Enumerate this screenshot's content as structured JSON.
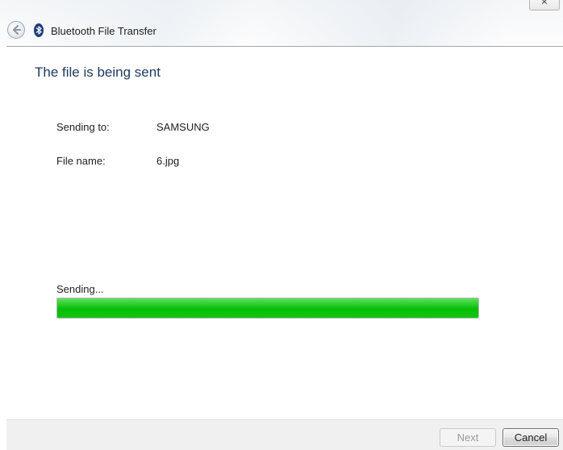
{
  "window": {
    "title": "Bluetooth File Transfer",
    "close_icon": "close-icon"
  },
  "main": {
    "heading": "The file is being sent",
    "sending_to_label": "Sending to:",
    "sending_to_value": "SAMSUNG",
    "file_name_label": "File name:",
    "file_name_value": "6.jpg",
    "progress_label": "Sending...",
    "progress_fraction": 1.0,
    "progress_color": "#08bd08"
  },
  "footer": {
    "next_label": "Next",
    "cancel_label": "Cancel"
  },
  "icons": {
    "back": "back-arrow-icon",
    "bluetooth": "bluetooth-icon"
  }
}
